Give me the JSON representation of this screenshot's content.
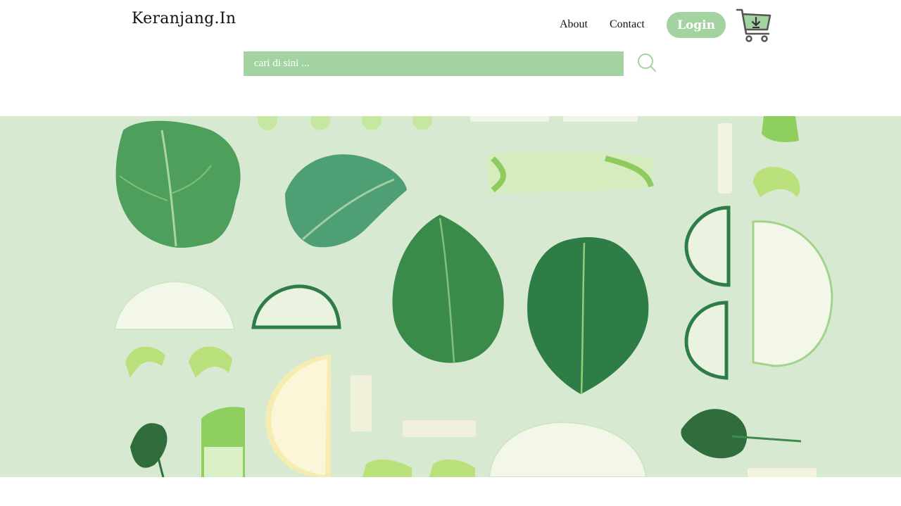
{
  "header": {
    "brand": "Keranjang.In",
    "nav": [
      {
        "label": "About"
      },
      {
        "label": "Contact"
      }
    ],
    "login_label": "Login",
    "cart_icon": "shopping-cart-download-icon"
  },
  "search": {
    "placeholder": "cari di sini ...",
    "value": "",
    "icon": "search-icon"
  },
  "hero": {
    "image": "flat-lay-green-vegetables-photo"
  },
  "colors": {
    "accent": "#a2d3a0",
    "hero_background": "#d7ead1",
    "leaf_dark": "#2f7d46",
    "leaf_light": "#7fc06a"
  }
}
